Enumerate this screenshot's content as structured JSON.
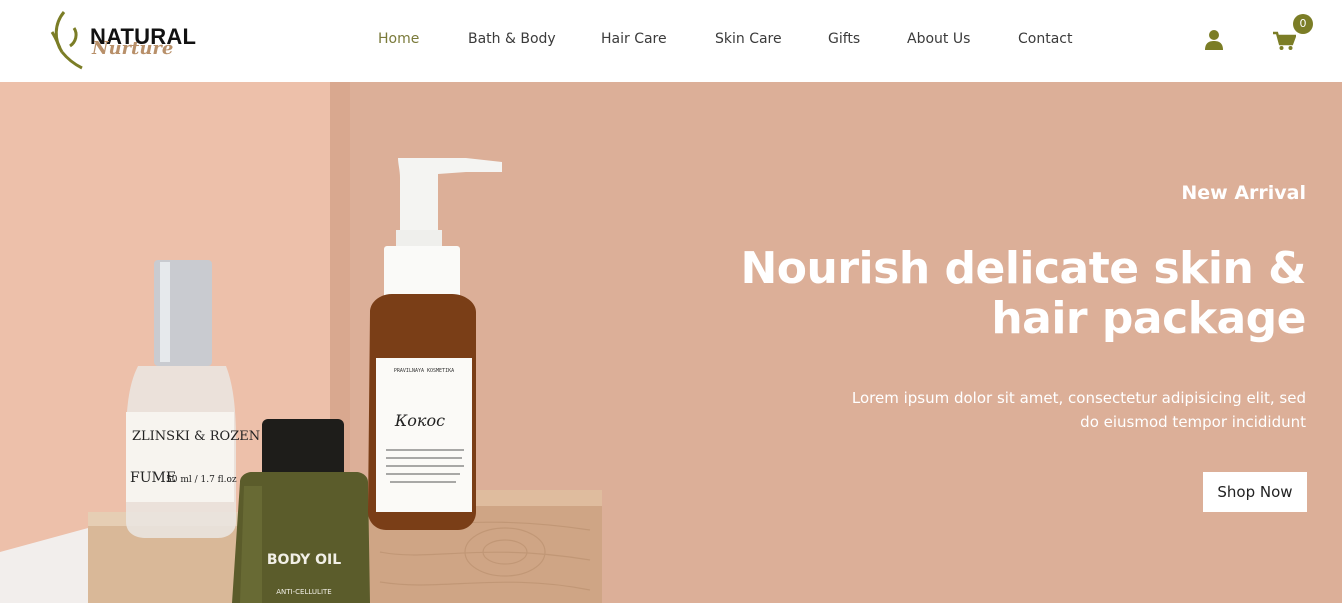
{
  "brand": {
    "name_line1": "NATURAL",
    "name_line2": "Nurture",
    "accent_color": "#7b7d26",
    "secondary_color": "#b8906a"
  },
  "nav": {
    "items": [
      {
        "label": "Home",
        "active": true
      },
      {
        "label": "Bath & Body"
      },
      {
        "label": "Hair Care"
      },
      {
        "label": "Skin Care"
      },
      {
        "label": "Gifts"
      },
      {
        "label": "About Us"
      },
      {
        "label": "Contact"
      }
    ]
  },
  "header_actions": {
    "user_icon": "user-icon",
    "cart_icon": "cart-icon",
    "cart_count": "0"
  },
  "hero": {
    "kicker": "New Arrival",
    "title": "Nourish delicate skin & hair package",
    "description": "Lorem ipsum dolor sit amet, consectetur adipisicing elit, sed do eiusmod tempor incididunt",
    "cta_label": "Shop Now",
    "background_color": "#dcaf98",
    "products": {
      "spray_label_line1": "ZLINSKI & ROZEN",
      "spray_label_line2": "FUME",
      "spray_label_size": "50 ml / 1.7 fl.oz",
      "oil_label": "BODY OIL",
      "oil_sublabel": "ANTI-CELLULITE",
      "dropper_brand": "PRAVILNAYA KOSMETIKA",
      "dropper_script": "Кокос"
    }
  }
}
